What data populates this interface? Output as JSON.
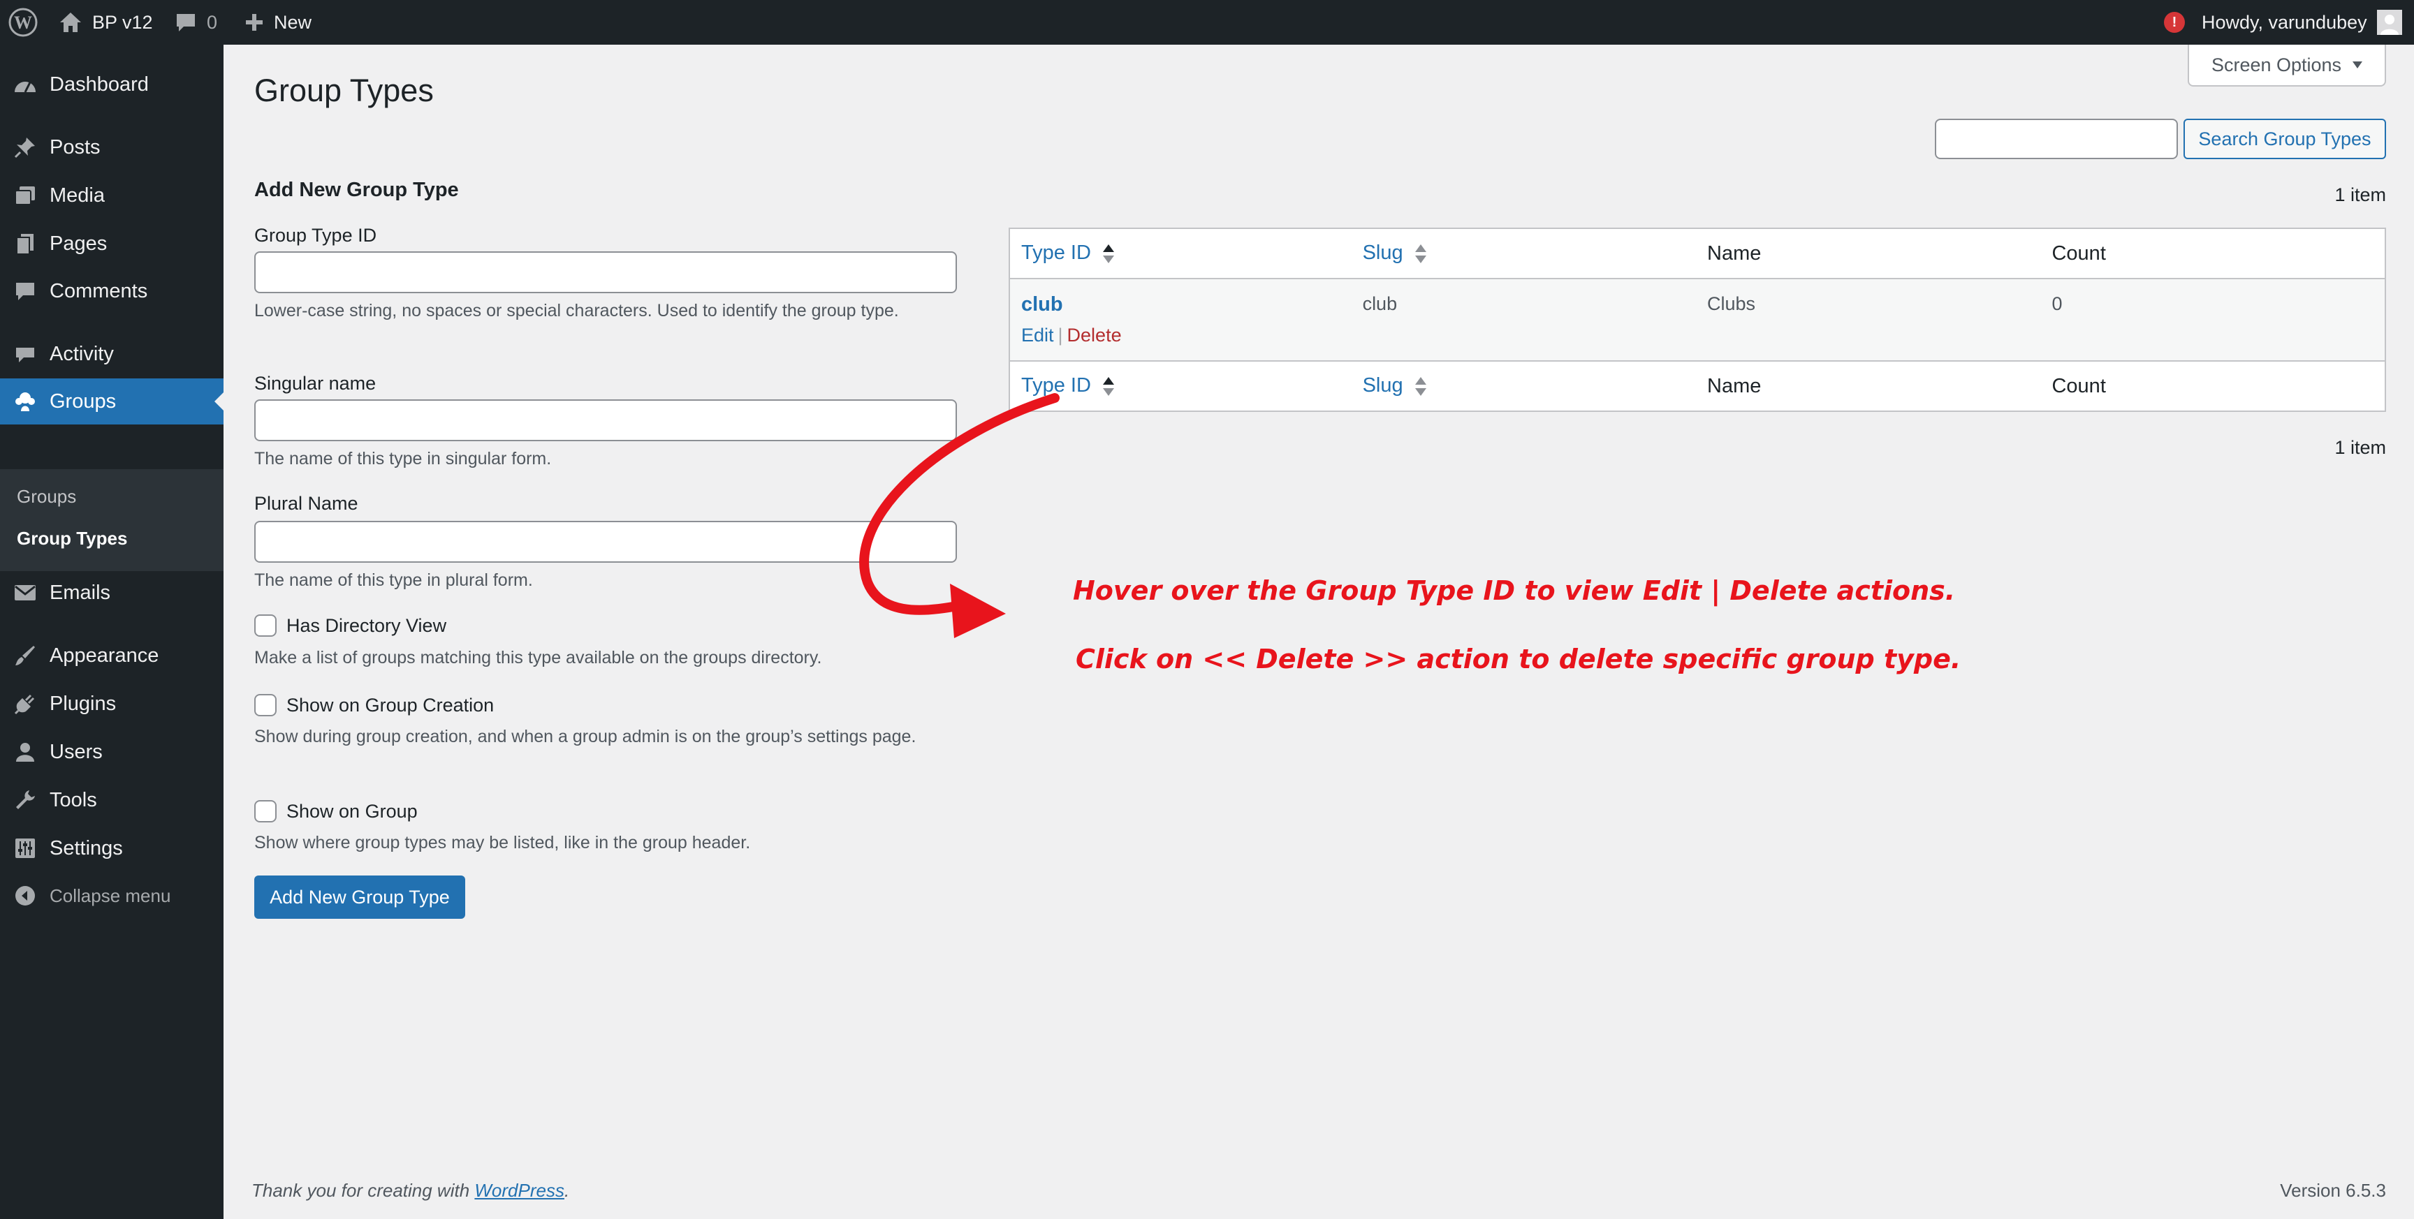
{
  "adminbar": {
    "site_name": "BP v12",
    "comments_count": "0",
    "new_label": "New",
    "howdy": "Howdy, varundubey",
    "notice_glyph": "!",
    "icons": [
      "wordpress-logo-icon",
      "home-icon",
      "comment-bubble-icon",
      "plus-icon",
      "notification-icon",
      "avatar-icon"
    ]
  },
  "sidebar": {
    "items": [
      {
        "label": "Dashboard",
        "icon": "dashboard-icon"
      },
      {
        "label": "Posts",
        "icon": "pushpin-icon"
      },
      {
        "label": "Media",
        "icon": "media-icon"
      },
      {
        "label": "Pages",
        "icon": "pages-icon"
      },
      {
        "label": "Comments",
        "icon": "comment-bubble-icon"
      },
      {
        "label": "Activity",
        "icon": "activity-icon"
      },
      {
        "label": "Groups",
        "icon": "groups-icon",
        "current": true
      },
      {
        "label": "Emails",
        "icon": "envelope-icon"
      },
      {
        "label": "Appearance",
        "icon": "paintbrush-icon"
      },
      {
        "label": "Plugins",
        "icon": "plug-icon"
      },
      {
        "label": "Users",
        "icon": "user-icon"
      },
      {
        "label": "Tools",
        "icon": "wrench-icon"
      },
      {
        "label": "Settings",
        "icon": "settings-sliders-icon"
      },
      {
        "label": "Collapse menu",
        "icon": "collapse-arrow-icon"
      }
    ],
    "submenu": [
      {
        "label": "Groups"
      },
      {
        "label": "Group Types",
        "current": true
      }
    ]
  },
  "page": {
    "title": "Group Types",
    "screen_options": "Screen Options",
    "search_value": "",
    "search_button": "Search Group Types"
  },
  "form": {
    "heading": "Add New Group Type",
    "type_id_label": "Group Type ID",
    "type_id_value": "",
    "type_id_desc": "Lower-case string, no spaces or special characters. Used to identify the group type.",
    "singular_label": "Singular name",
    "singular_value": "",
    "singular_desc": "The name of this type in singular form.",
    "plural_label": "Plural Name",
    "plural_value": "",
    "plural_desc": "The name of this type in plural form.",
    "directory_label": "Has Directory View",
    "directory_desc": "Make a list of groups matching this type available on the groups directory.",
    "creation_label": "Show on Group Creation",
    "creation_desc": "Show during group creation, and when a group admin is on the group’s settings page.",
    "group_label": "Show on Group",
    "group_desc": "Show where group types may be listed, like in the group header.",
    "submit_label": "Add New Group Type"
  },
  "table": {
    "count_top": "1 item",
    "count_bottom": "1 item",
    "columns": [
      "Type ID",
      "Slug",
      "Name",
      "Count"
    ],
    "rows": [
      {
        "type_id": "club",
        "slug": "club",
        "name": "Clubs",
        "count": "0",
        "edit": "Edit",
        "sep": "|",
        "delete": "Delete"
      }
    ]
  },
  "annotation": {
    "line1": "Hover over the Group Type ID to view Edit | Delete actions.",
    "line2": "Click on << Delete >> action to delete specific group type.",
    "color": "#e8141c"
  },
  "footer": {
    "thanks_prefix": "Thank you for creating with ",
    "thanks_link": "WordPress",
    "thanks_suffix": ".",
    "version": "Version 6.5.3"
  },
  "colors": {
    "admin_dark": "#1d2327",
    "accent_blue": "#2271b1",
    "delete_red": "#b32d2e",
    "background": "#f0f0f1"
  }
}
